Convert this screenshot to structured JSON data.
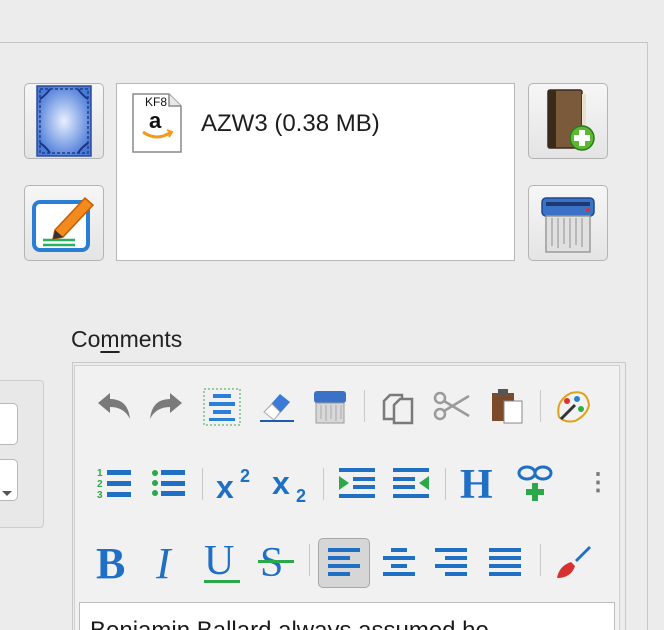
{
  "format": {
    "badge": "KF8",
    "badge_logo": "a",
    "label": "AZW3 (0.38 MB)"
  },
  "comments": {
    "label_prefix": "Co",
    "label_underlined": "m",
    "label_suffix": "ments",
    "body_text": "Benjamin Ballard always assumed he"
  },
  "toolbar": {
    "row1": [
      "undo-icon",
      "redo-icon",
      "select-all-icon",
      "eraser-icon",
      "shredder-icon",
      "copy-icon",
      "cut-icon",
      "paste-icon",
      "palette-icon"
    ],
    "row2": [
      "ordered-list-icon",
      "unordered-list-icon",
      "superscript-icon",
      "subscript-icon",
      "indent-icon",
      "outdent-icon",
      "heading-icon",
      "insert-link-icon",
      "more-icon"
    ],
    "row3": [
      "bold-icon",
      "italic-icon",
      "underline-icon",
      "strikethrough-icon",
      "align-left-icon",
      "align-center-icon",
      "align-right-icon",
      "justify-icon",
      "brush-icon"
    ],
    "glyphs": {
      "superscript_base": "x",
      "superscript_exp": "2",
      "subscript_base": "x",
      "subscript_sub": "2",
      "heading": "H",
      "bold": "B",
      "italic": "I",
      "underline": "U",
      "strike": "S",
      "ordered_nums": [
        "1",
        "2",
        "3"
      ],
      "more": "⋮"
    }
  },
  "colors": {
    "accent_blue": "#1f6fc5",
    "green": "#2aa84a"
  }
}
